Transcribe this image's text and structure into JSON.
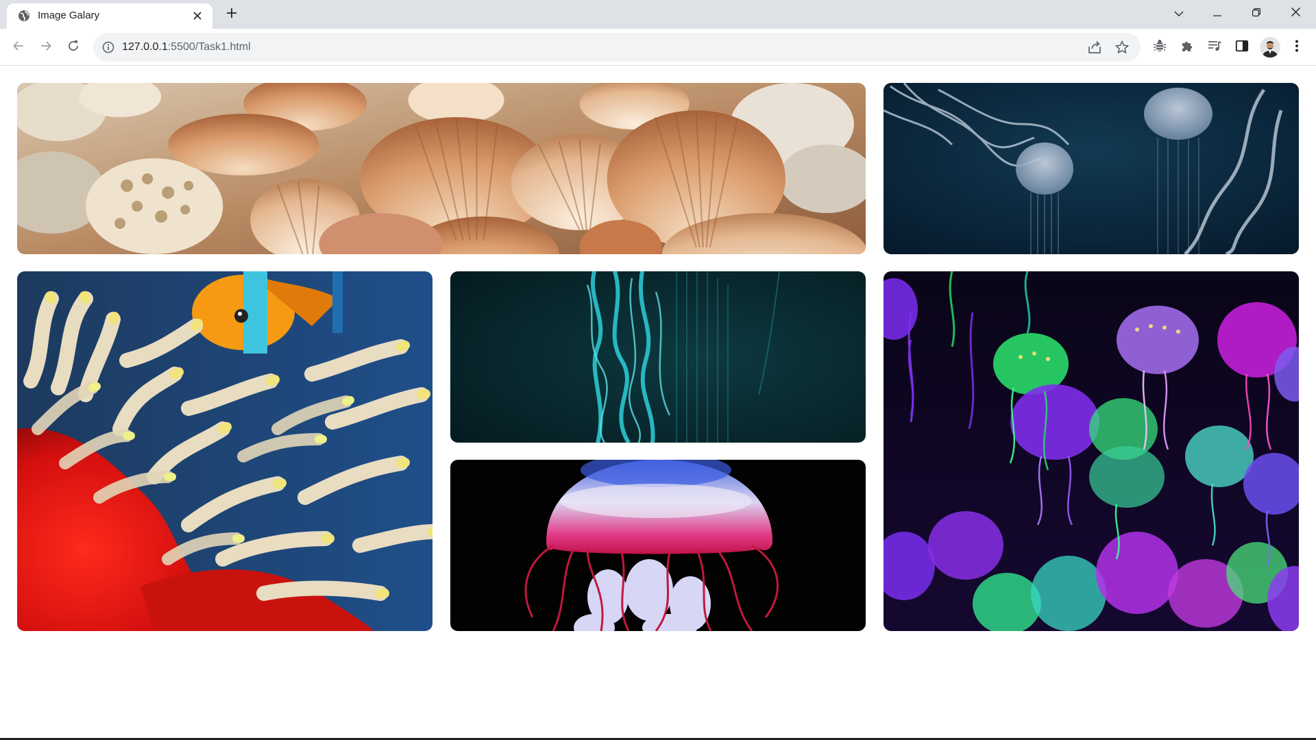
{
  "browser": {
    "tab_title": "Image Galary",
    "url_host": "127.0.0.1",
    "url_path": ":5500/Task1.html"
  },
  "icons": {
    "tab_favicon": "globe-icon",
    "tab_close": "close-icon",
    "new_tab": "plus-icon",
    "tab_search": "chevron-down-icon",
    "minimize": "minimize-icon",
    "restore": "restore-icon",
    "close_window": "close-icon",
    "back": "arrow-left-icon",
    "forward": "arrow-right-icon",
    "reload": "reload-icon",
    "site_info": "info-icon",
    "share": "share-icon",
    "bookmark": "star-icon",
    "extension": "bug-icon",
    "extensions": "puzzle-icon",
    "media": "media-queue-icon",
    "side_panel": "side-panel-icon",
    "profile": "avatar",
    "menu": "more-vert-icon"
  },
  "gallery": {
    "images": [
      {
        "subject": "seashells"
      },
      {
        "subject": "jellyfish-dark-blue"
      },
      {
        "subject": "clownfish-anemone"
      },
      {
        "subject": "teal-jellyfish-tentacles"
      },
      {
        "subject": "red-jellyfish"
      },
      {
        "subject": "neon-jellyfish"
      }
    ]
  },
  "colors": {
    "tabstrip": "#dee1e6",
    "omnibox": "#f1f3f4",
    "text": "#202124",
    "icon": "#5f6368"
  }
}
